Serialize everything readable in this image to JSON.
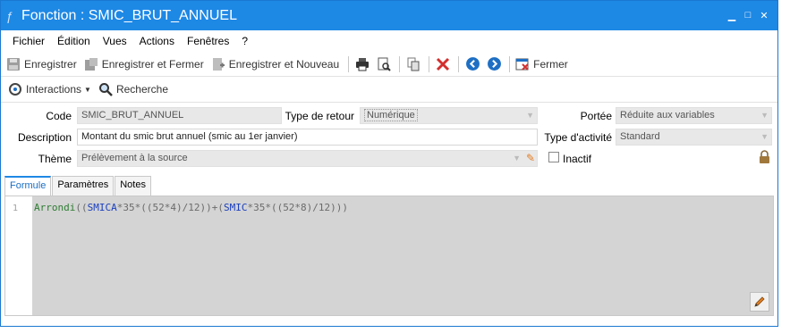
{
  "window": {
    "title": "Fonction : SMIC_BRUT_ANNUEL"
  },
  "menu": [
    "Fichier",
    "Édition",
    "Vues",
    "Actions",
    "Fenêtres",
    "?"
  ],
  "toolbar": {
    "save": "Enregistrer",
    "save_close": "Enregistrer et Fermer",
    "save_new": "Enregistrer et Nouveau",
    "close": "Fermer"
  },
  "toolbar2": {
    "interactions": "Interactions",
    "search": "Recherche"
  },
  "form": {
    "code_label": "Code",
    "code_value": "SMIC_BRUT_ANNUEL",
    "return_type_label": "Type de retour",
    "return_type_value": "Numérique",
    "scope_label": "Portée",
    "scope_value": "Réduite aux variables",
    "description_label": "Description",
    "description_value": "Montant du smic brut annuel (smic au 1er janvier)",
    "activity_label": "Type d'activité",
    "activity_value": "Standard",
    "theme_label": "Thème",
    "theme_value": "Prélèvement à la source",
    "inactive_label": "Inactif"
  },
  "tabs": [
    "Formule",
    "Paramètres",
    "Notes"
  ],
  "editor": {
    "line_number": "1",
    "tokens": [
      {
        "t": "Arrondi",
        "c": "fn"
      },
      {
        "t": "((",
        "c": "op"
      },
      {
        "t": "SMICA",
        "c": "var"
      },
      {
        "t": "*35*((52*4)/12))+(",
        "c": "op"
      },
      {
        "t": "SMIC",
        "c": "var"
      },
      {
        "t": "*35*((52*8)/12)))",
        "c": "op"
      }
    ]
  },
  "colors": {
    "title_bar": "#1e88e5",
    "code_fn": "#2e7d32",
    "code_var": "#1a3fbf",
    "code_op": "#6b6b6b"
  }
}
